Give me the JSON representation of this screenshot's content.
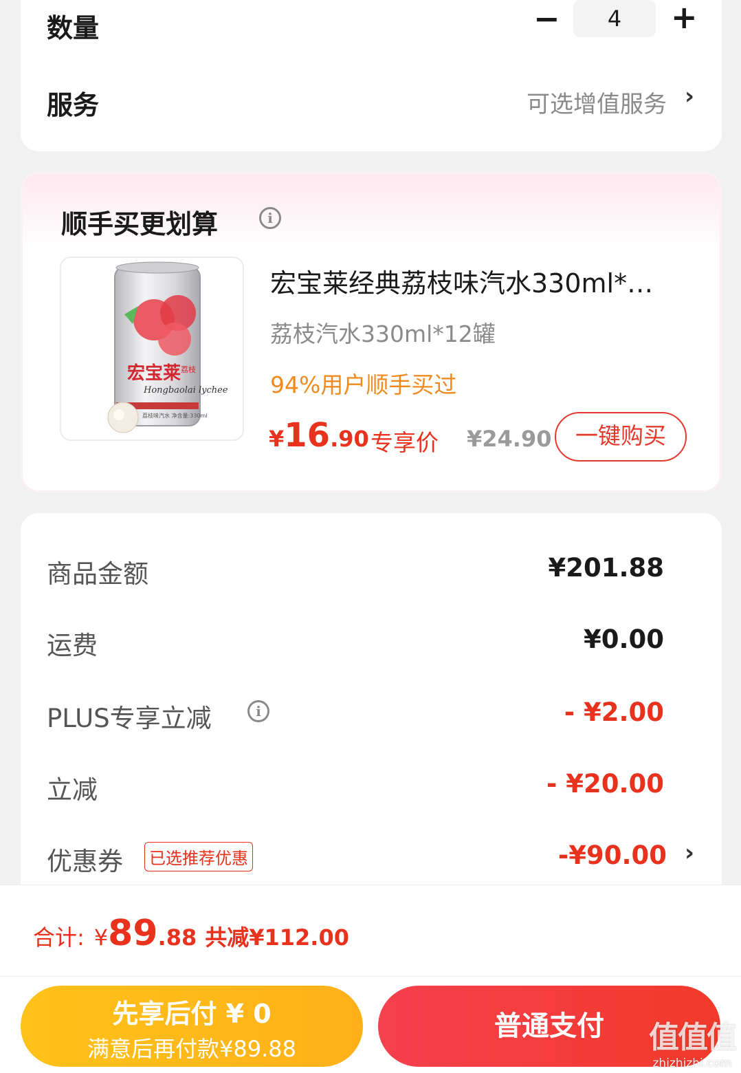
{
  "quantity_section": {
    "label": "数量",
    "minus_symbol": "−",
    "value": "4",
    "plus_symbol": "+"
  },
  "service_section": {
    "label": "服务",
    "value": "可选增值服务",
    "chevron": "›"
  },
  "recommendation": {
    "title": "顺手买更划算",
    "info_icon": "i",
    "product": {
      "title": "宏宝莱经典荔枝味汽水330ml*…",
      "spec": "荔枝汽水330ml*12罐",
      "note": "94%用户顺手买过",
      "price_currency": "¥",
      "price_int": "16",
      "price_dec": ".90",
      "price_tag": "专享价",
      "original_price": "¥24.90",
      "buy_button": "一键购买",
      "image": {
        "brand_text": "宏宝莱",
        "brand_small": "荔枝",
        "script_text": "Hongbaolai lychee",
        "bottom_text": "荔枝味汽水  净含量:330ml"
      }
    }
  },
  "fees": {
    "goods_amount": {
      "label": "商品金额",
      "value": "¥201.88"
    },
    "shipping": {
      "label": "运费",
      "value": "¥0.00"
    },
    "plus_discount": {
      "label": "PLUS专享立减",
      "info_icon": "i",
      "value": "- ¥2.00"
    },
    "instant_discount": {
      "label": "立减",
      "value": "- ¥20.00"
    },
    "coupon": {
      "label": "优惠券",
      "badge": "已选推荐优惠",
      "value": "-¥90.00",
      "chevron": "›"
    }
  },
  "bottom_bar": {
    "total_label": "合计:",
    "total_currency": "¥",
    "total_int": "89",
    "total_dec": ".88",
    "total_saved": "共减¥112.00",
    "pay_later_title": "先享后付 ¥ 0",
    "pay_later_sub": "满意后再付款¥89.88",
    "pay_button": "普通支付"
  },
  "watermark": {
    "logo": "值值值",
    "url": "zhizhizhi.com"
  },
  "colors": {
    "accent_red": "#e8321e",
    "note_orange": "#f08a1c",
    "pay_later_yellow": "#ffb019",
    "pay_red": "#f23a2a"
  }
}
